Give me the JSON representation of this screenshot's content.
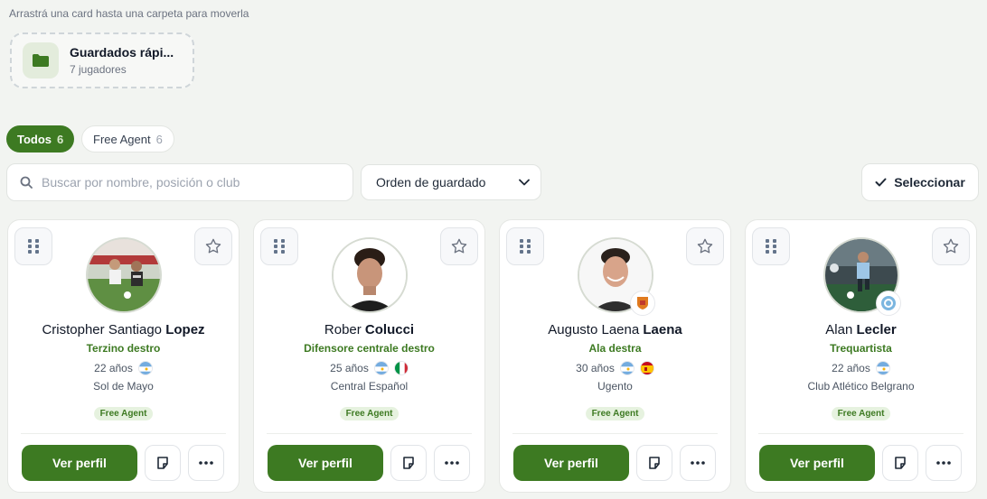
{
  "hint": "Arrastrá una card hasta una carpeta para moverla",
  "folder": {
    "name": "Guardados rápi...",
    "count": "7 jugadores",
    "icon": "folder-icon"
  },
  "filters": {
    "all_label": "Todos",
    "all_count": "6",
    "fa_label": "Free Agent",
    "fa_count": "6"
  },
  "search": {
    "placeholder": "Buscar por nombre, posición o club"
  },
  "sort": {
    "value": "Orden de guardado"
  },
  "select_label": "Seleccionar",
  "accent": "#3d7a22",
  "cards": [
    {
      "first": "Cristopher Santiago",
      "last": "Lopez",
      "position": "Terzino destro",
      "age": "22 años",
      "flags": [
        "argentina"
      ],
      "club": "Sol de Mayo",
      "badge": "Free Agent",
      "cta": "Ver perfil"
    },
    {
      "first": "Rober",
      "last": "Colucci",
      "position": "Difensore centrale destro",
      "age": "25 años",
      "flags": [
        "argentina",
        "italy"
      ],
      "club": "Central Español",
      "badge": "Free Agent",
      "cta": "Ver perfil"
    },
    {
      "first": "Augusto Laena",
      "last": "Laena",
      "position": "Ala destra",
      "age": "30 años",
      "flags": [
        "argentina",
        "spain"
      ],
      "club": "Ugento",
      "badge": "Free Agent",
      "cta": "Ver perfil"
    },
    {
      "first": "Alan",
      "last": "Lecler",
      "position": "Trequartista",
      "age": "22 años",
      "flags": [
        "argentina"
      ],
      "club": "Club Atlético Belgrano",
      "badge": "Free Agent",
      "cta": "Ver perfil"
    }
  ]
}
